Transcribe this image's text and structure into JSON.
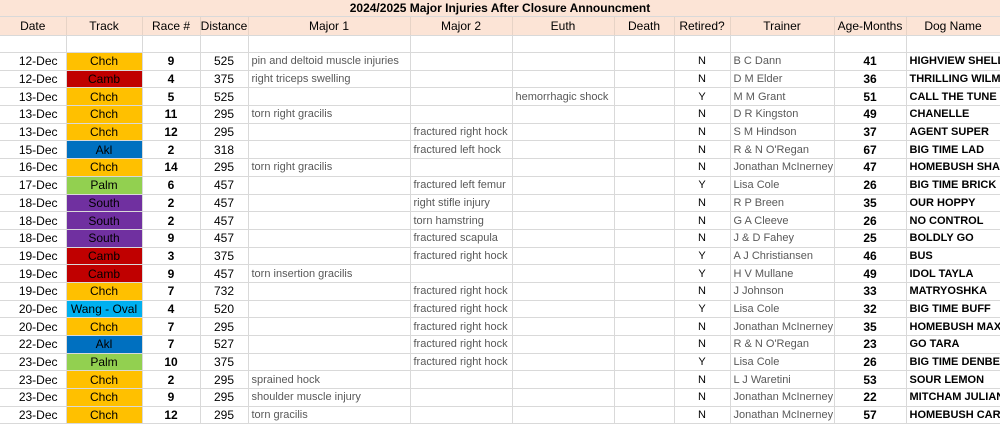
{
  "title": "2024/2025 Major Injuries After Closure Announcment",
  "columns": [
    "Date",
    "Track",
    "Race #",
    "Distance",
    "Major 1",
    "Major 2",
    "Euth",
    "Death",
    "Retired?",
    "Trainer",
    "Age-Months",
    "Dog Name"
  ],
  "track_colors": {
    "Chch": "#ffc000",
    "Camb": "#c00000",
    "Akl": "#0070c0",
    "Palm": "#92d050",
    "South": "#7030a0",
    "Wang - Oval": "#00b0f0"
  },
  "rows": [
    {
      "date": "12-Dec",
      "track": "Chch",
      "race": "9",
      "distance": "525",
      "major1": "pin and deltoid muscle injuries",
      "major2": "",
      "euth": "",
      "death": "",
      "retired": "N",
      "trainer": "B C Dann",
      "age": "41",
      "dog": "HIGHVIEW SHELLY"
    },
    {
      "date": "12-Dec",
      "track": "Camb",
      "race": "4",
      "distance": "375",
      "major1": "right triceps swelling",
      "major2": "",
      "euth": "",
      "death": "",
      "retired": "N",
      "trainer": "D M Elder",
      "age": "36",
      "dog": "THRILLING WILMA"
    },
    {
      "date": "13-Dec",
      "track": "Chch",
      "race": "5",
      "distance": "525",
      "major1": "",
      "major2": "",
      "euth": "hemorrhagic shock",
      "death": "",
      "retired": "Y",
      "trainer": "M M Grant",
      "age": "51",
      "dog": "CALL THE TUNE"
    },
    {
      "date": "13-Dec",
      "track": "Chch",
      "race": "11",
      "distance": "295",
      "major1": "torn right gracilis",
      "major2": "",
      "euth": "",
      "death": "",
      "retired": "N",
      "trainer": "D R Kingston",
      "age": "49",
      "dog": "CHANELLE"
    },
    {
      "date": "13-Dec",
      "track": "Chch",
      "race": "12",
      "distance": "295",
      "major1": "",
      "major2": "fractured right hock",
      "euth": "",
      "death": "",
      "retired": "N",
      "trainer": "S M Hindson",
      "age": "37",
      "dog": "AGENT SUPER"
    },
    {
      "date": "15-Dec",
      "track": "Akl",
      "race": "2",
      "distance": "318",
      "major1": "",
      "major2": "fractured left hock",
      "euth": "",
      "death": "",
      "retired": "N",
      "trainer": "R & N O'Regan",
      "age": "67",
      "dog": "BIG TIME LAD"
    },
    {
      "date": "16-Dec",
      "track": "Chch",
      "race": "14",
      "distance": "295",
      "major1": "torn right gracilis",
      "major2": "",
      "euth": "",
      "death": "",
      "retired": "N",
      "trainer": "Jonathan McInerney",
      "age": "47",
      "dog": "HOMEBUSH SHADY"
    },
    {
      "date": "17-Dec",
      "track": "Palm",
      "race": "6",
      "distance": "457",
      "major1": "",
      "major2": "fractured left femur",
      "euth": "",
      "death": "",
      "retired": "Y",
      "trainer": "Lisa Cole",
      "age": "26",
      "dog": "BIG TIME BRICK"
    },
    {
      "date": "18-Dec",
      "track": "South",
      "race": "2",
      "distance": "457",
      "major1": "",
      "major2": "right stifle injury",
      "euth": "",
      "death": "",
      "retired": "N",
      "trainer": "R P Breen",
      "age": "35",
      "dog": "OUR HOPPY"
    },
    {
      "date": "18-Dec",
      "track": "South",
      "race": "2",
      "distance": "457",
      "major1": "",
      "major2": "torn hamstring",
      "euth": "",
      "death": "",
      "retired": "N",
      "trainer": "G A Cleeve",
      "age": "26",
      "dog": "NO CONTROL"
    },
    {
      "date": "18-Dec",
      "track": "South",
      "race": "9",
      "distance": "457",
      "major1": "",
      "major2": "fractured scapula",
      "euth": "",
      "death": "",
      "retired": "N",
      "trainer": "J & D Fahey",
      "age": "25",
      "dog": "BOLDLY GO"
    },
    {
      "date": "19-Dec",
      "track": "Camb",
      "race": "3",
      "distance": "375",
      "major1": "",
      "major2": "fractured right hock",
      "euth": "",
      "death": "",
      "retired": "Y",
      "trainer": "A J Christiansen",
      "age": "46",
      "dog": "BUS"
    },
    {
      "date": "19-Dec",
      "track": "Camb",
      "race": "9",
      "distance": "457",
      "major1": "torn insertion gracilis",
      "major2": "",
      "euth": "",
      "death": "",
      "retired": "Y",
      "trainer": "H V Mullane",
      "age": "49",
      "dog": "IDOL TAYLA"
    },
    {
      "date": "19-Dec",
      "track": "Chch",
      "race": "7",
      "distance": "732",
      "major1": "",
      "major2": "fractured right hock",
      "euth": "",
      "death": "",
      "retired": "N",
      "trainer": "J Johnson",
      "age": "33",
      "dog": "MATRYOSHKA"
    },
    {
      "date": "20-Dec",
      "track": "Wang - Oval",
      "race": "4",
      "distance": "520",
      "major1": "",
      "major2": "fractured right hock",
      "euth": "",
      "death": "",
      "retired": "Y",
      "trainer": "Lisa Cole",
      "age": "32",
      "dog": "BIG TIME BUFF"
    },
    {
      "date": "20-Dec",
      "track": "Chch",
      "race": "7",
      "distance": "295",
      "major1": "",
      "major2": "fractured right hock",
      "euth": "",
      "death": "",
      "retired": "N",
      "trainer": "Jonathan McInerney",
      "age": "35",
      "dog": "HOMEBUSH MAX"
    },
    {
      "date": "22-Dec",
      "track": "Akl",
      "race": "7",
      "distance": "527",
      "major1": "",
      "major2": "fractured right hock",
      "euth": "",
      "death": "",
      "retired": "N",
      "trainer": "R & N O'Regan",
      "age": "23",
      "dog": "GO TARA"
    },
    {
      "date": "23-Dec",
      "track": "Palm",
      "race": "10",
      "distance": "375",
      "major1": "",
      "major2": "fractured right hock",
      "euth": "",
      "death": "",
      "retired": "Y",
      "trainer": "Lisa Cole",
      "age": "26",
      "dog": "BIG TIME DENBE"
    },
    {
      "date": "23-Dec",
      "track": "Chch",
      "race": "2",
      "distance": "295",
      "major1": "sprained hock",
      "major2": "",
      "euth": "",
      "death": "",
      "retired": "N",
      "trainer": "L J Waretini",
      "age": "53",
      "dog": "SOUR LEMON"
    },
    {
      "date": "23-Dec",
      "track": "Chch",
      "race": "9",
      "distance": "295",
      "major1": "shoulder muscle injury",
      "major2": "",
      "euth": "",
      "death": "",
      "retired": "N",
      "trainer": "Jonathan McInerney",
      "age": "22",
      "dog": "MITCHAM JULIAN"
    },
    {
      "date": "23-Dec",
      "track": "Chch",
      "race": "12",
      "distance": "295",
      "major1": "torn gracilis",
      "major2": "",
      "euth": "",
      "death": "",
      "retired": "N",
      "trainer": "Jonathan McInerney",
      "age": "57",
      "dog": "HOMEBUSH CARDI"
    }
  ]
}
